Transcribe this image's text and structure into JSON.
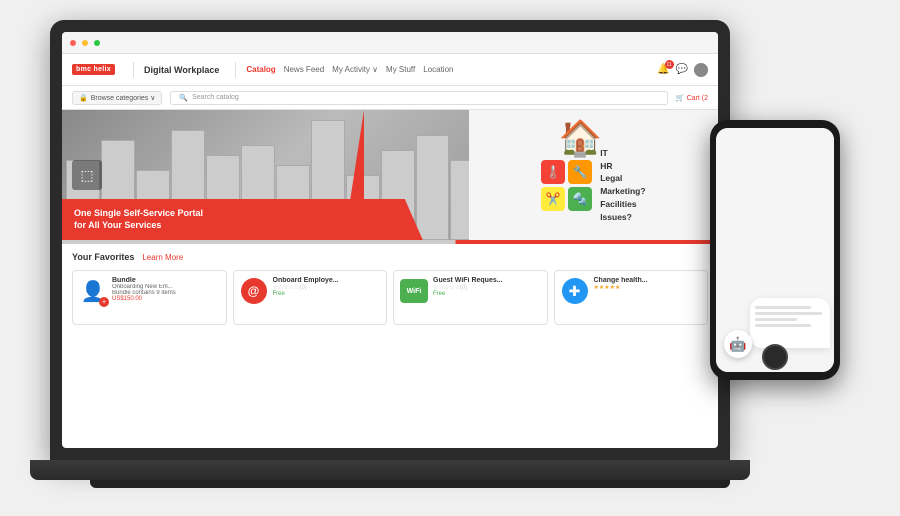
{
  "app": {
    "title": "Digital Workplace",
    "logo_text": "bmc helix",
    "nav_links": [
      {
        "label": "Catalog",
        "active": true
      },
      {
        "label": "News Feed",
        "active": false
      },
      {
        "label": "My Activity ∨",
        "active": false
      },
      {
        "label": "My Stuff",
        "active": false
      },
      {
        "label": "Location",
        "active": false
      }
    ],
    "notification_count": "11",
    "search_placeholder": "Search catalog",
    "browse_label": "Browse categories ∨",
    "cart_label": "Cart (2",
    "learn_more": "Learn More",
    "favorites_title": "Your Favorites"
  },
  "hero": {
    "main_text": "One Single Self-Service Portal\nfor All Your Services",
    "right_text": "IT\nHR\nLegal\nMarketing?\nFacilities\nIssues?"
  },
  "favorites": [
    {
      "title": "Bundle",
      "subtitle": "Onboarding New Em...",
      "desc": "Bundle contains 9 items",
      "price": "US$150.00",
      "stars": "☆☆☆☆☆",
      "icon": "👤",
      "icon_color": "#2196f3"
    },
    {
      "title": "Onboard Employe...",
      "subtitle": "",
      "desc": "",
      "price_label": "Free",
      "stars": "☆☆☆☆☆(0)",
      "icon": "@",
      "icon_color": "#e8392e"
    },
    {
      "title": "Guest WiFi Reques...",
      "subtitle": "",
      "desc": "",
      "price_label": "Free",
      "stars": "☆☆☆☆☆(0)",
      "icon": "WiFi",
      "icon_color": "#4caf50"
    },
    {
      "title": "Change health...",
      "subtitle": "",
      "desc": "",
      "price_label": "",
      "stars": "★★★★★",
      "icon": "✚",
      "icon_color": "#2196f3"
    }
  ],
  "phone": {
    "chatbot_icon": "🤖"
  },
  "browser": {
    "dots": [
      "#ff5f57",
      "#febc2e",
      "#28c840"
    ]
  }
}
